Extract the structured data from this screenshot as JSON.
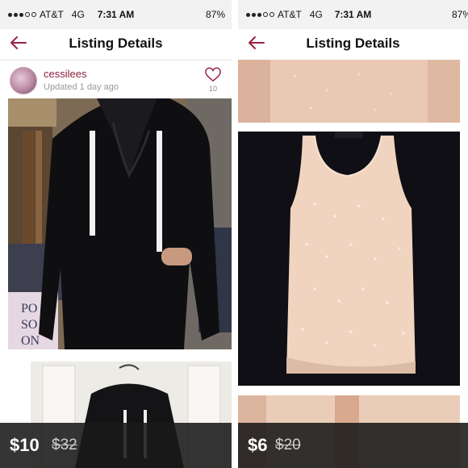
{
  "left": {
    "status": {
      "carrier": "AT&T",
      "network": "4G",
      "time": "7:31 AM",
      "battery": "87%"
    },
    "nav": {
      "title": "Listing Details",
      "back_icon": "back-arrow-icon"
    },
    "user": {
      "username": "cessilees",
      "updated": "Updated 1 day ago",
      "likes": "10",
      "like_icon": "heart-outline-icon"
    },
    "price": {
      "current": "$10",
      "original": "$32"
    },
    "colors": {
      "accent": "#9b2142",
      "pricebar": "#191919"
    }
  },
  "right": {
    "status": {
      "carrier": "AT&T",
      "network": "4G",
      "time": "7:31 AM",
      "battery": "87%"
    },
    "nav": {
      "title": "Listing Details",
      "back_icon": "back-arrow-icon"
    },
    "price": {
      "current": "$6",
      "original": "$20"
    }
  }
}
